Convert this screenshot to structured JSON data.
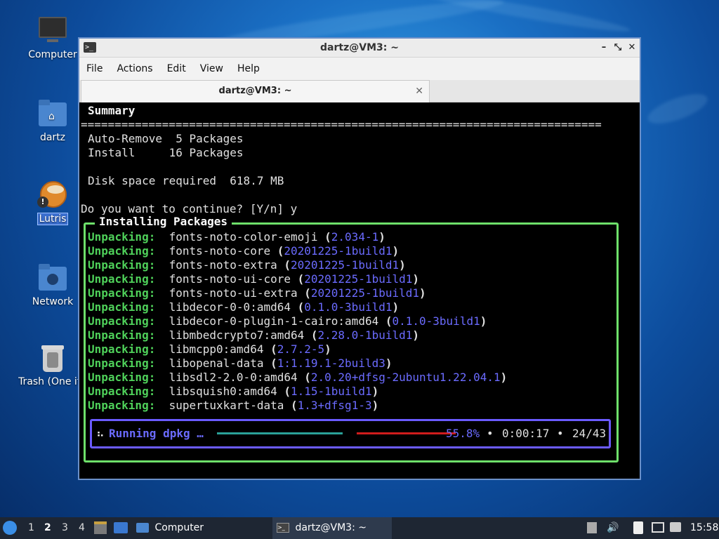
{
  "desktop": {
    "icons": [
      {
        "label": "Computer"
      },
      {
        "label": "dartz"
      },
      {
        "label": "Lutris"
      },
      {
        "label": "Network"
      },
      {
        "label": "Trash (One ite"
      }
    ]
  },
  "window": {
    "title": "dartz@VM3: ~",
    "controls": {
      "minimize": "–",
      "maximize": "⤡",
      "close": "✕"
    },
    "menu": [
      "File",
      "Actions",
      "Edit",
      "View",
      "Help"
    ],
    "tab": {
      "label": "dartz@VM3: ~",
      "close": "✕"
    }
  },
  "terminal": {
    "summary_heading": "Summary",
    "separator": "=============================================================================",
    "auto_remove": "Auto-Remove  5 Packages",
    "install": "Install     16 Packages",
    "disk_space": "Disk space required  618.7 MB",
    "prompt": "Do you want to continue? [Y/n] y",
    "box_title": "Installing Packages",
    "unpack_label": "Unpacking:",
    "packages": [
      {
        "name": "fonts-noto-color-emoji",
        "version": "2.034-1"
      },
      {
        "name": "fonts-noto-core",
        "version": "20201225-1build1"
      },
      {
        "name": "fonts-noto-extra",
        "version": "20201225-1build1"
      },
      {
        "name": "fonts-noto-ui-core",
        "version": "20201225-1build1"
      },
      {
        "name": "fonts-noto-ui-extra",
        "version": "20201225-1build1"
      },
      {
        "name": "libdecor-0-0:amd64",
        "version": "0.1.0-3build1"
      },
      {
        "name": "libdecor-0-plugin-1-cairo:amd64",
        "version": "0.1.0-3build1"
      },
      {
        "name": "libmbedcrypto7:amd64",
        "version": "2.28.0-1build1"
      },
      {
        "name": "libmcpp0:amd64",
        "version": "2.7.2-5"
      },
      {
        "name": "libopenal-data",
        "version": "1:1.19.1-2build3"
      },
      {
        "name": "libsdl2-2.0-0:amd64",
        "version": "2.0.20+dfsg-2ubuntu1.22.04.1"
      },
      {
        "name": "libsquish0:amd64",
        "version": "1.15-1build1"
      },
      {
        "name": "supertuxkart-data",
        "version": "1.3+dfsg1-3"
      }
    ],
    "progress": {
      "spinner": "⠦",
      "label": "Running dpkg …",
      "percent_text": "55.8%",
      "fraction": 0.558,
      "elapsed": "0:00:17",
      "count": "24/43",
      "bullet": "•"
    }
  },
  "taskbar": {
    "workspaces": [
      "1",
      "2",
      "3",
      "4"
    ],
    "current_workspace": "2",
    "computer_label": "Computer",
    "active_window": "dartz@VM3: ~",
    "clock": "15:58"
  }
}
